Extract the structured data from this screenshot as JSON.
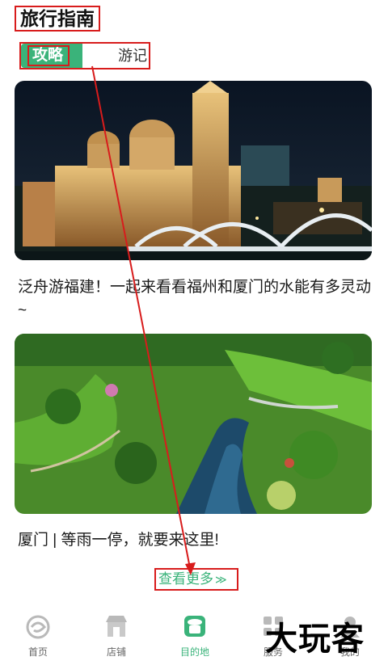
{
  "header": {
    "title": "旅行指南"
  },
  "tabs": [
    {
      "label": "攻略",
      "active": true
    },
    {
      "label": "游记",
      "active": false
    }
  ],
  "articles": [
    {
      "title": "泛舟游福建！一起来看看福州和厦门的水能有多灵动~"
    },
    {
      "title": "厦门 | 等雨一停，就要来这里!"
    }
  ],
  "more": {
    "label": "查看更多",
    "chevron": "≫"
  },
  "bottom_nav": [
    {
      "label": "首页",
      "icon": "home-icon"
    },
    {
      "label": "店铺",
      "icon": "store-icon"
    },
    {
      "label": "目的地",
      "icon": "destination-icon",
      "active": true
    },
    {
      "label": "服务",
      "icon": "service-icon"
    },
    {
      "label": "我的",
      "icon": "profile-icon"
    }
  ],
  "watermark": "大玩客",
  "colors": {
    "accent": "#3ab37a",
    "annotation": "#d81c1c"
  }
}
